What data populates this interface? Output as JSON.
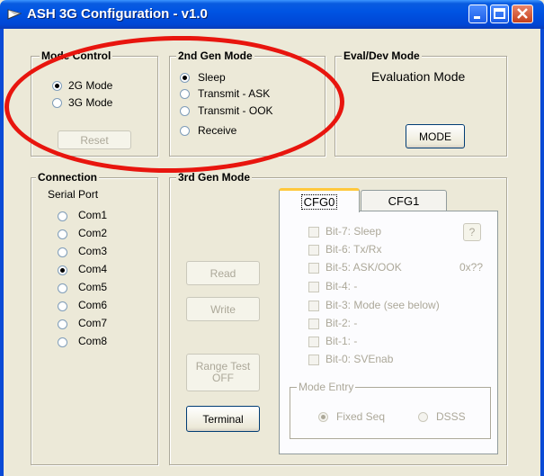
{
  "window": {
    "title": "ASH 3G Configuration - v1.0"
  },
  "mode_control": {
    "label": "Mode Control",
    "options": [
      {
        "label": "2G Mode",
        "selected": true
      },
      {
        "label": "3G Mode",
        "selected": false
      }
    ],
    "reset_label": "Reset"
  },
  "gen2_mode": {
    "label": "2nd Gen Mode",
    "options": [
      {
        "label": "Sleep",
        "selected": true
      },
      {
        "label": "Transmit - ASK",
        "selected": false
      },
      {
        "label": "Transmit - OOK",
        "selected": false
      },
      {
        "label": "Receive",
        "selected": false
      }
    ]
  },
  "eval_dev": {
    "label": "Eval/Dev Mode",
    "status": "Evaluation Mode",
    "mode_button": "MODE"
  },
  "connection": {
    "label": "Connection",
    "sublabel": "Serial Port",
    "ports": [
      {
        "label": "Com1",
        "selected": false
      },
      {
        "label": "Com2",
        "selected": false
      },
      {
        "label": "Com3",
        "selected": false
      },
      {
        "label": "Com4",
        "selected": true
      },
      {
        "label": "Com5",
        "selected": false
      },
      {
        "label": "Com6",
        "selected": false
      },
      {
        "label": "Com7",
        "selected": false
      },
      {
        "label": "Com8",
        "selected": false
      }
    ]
  },
  "gen3_mode": {
    "label": "3rd Gen Mode",
    "buttons": {
      "read": "Read",
      "write": "Write",
      "range_test": "Range Test\nOFF",
      "terminal": "Terminal"
    },
    "tabs": [
      {
        "label": "CFG0",
        "active": true
      },
      {
        "label": "CFG1",
        "active": false
      }
    ],
    "bits": [
      "Bit-7: Sleep",
      "Bit-6: Tx/Rx",
      "Bit-5: ASK/OOK",
      "Bit-4: -",
      "Bit-3: Mode (see below)",
      "Bit-2: -",
      "Bit-1: -",
      "Bit-0: SVEnab"
    ],
    "help_button": "?",
    "hex_value": "0x??",
    "mode_entry": {
      "label": "Mode Entry",
      "options": [
        {
          "label": "Fixed Seq",
          "selected": true
        },
        {
          "label": "DSSS",
          "selected": false
        }
      ]
    }
  },
  "colors": {
    "annotation_ellipse": "#e8150e",
    "titlebar": "#0054e3"
  }
}
